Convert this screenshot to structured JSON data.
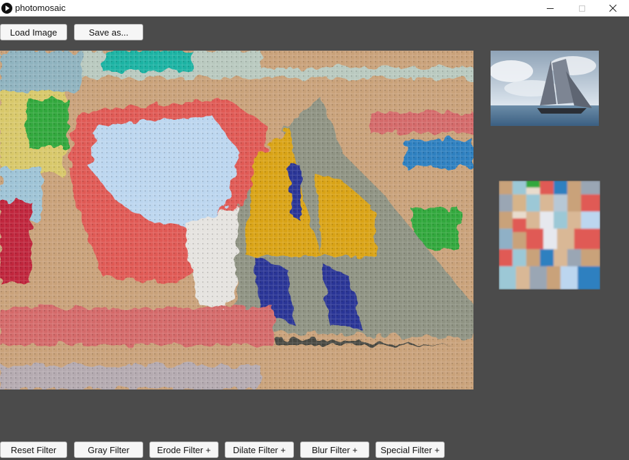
{
  "window": {
    "title": "photomosaic"
  },
  "toolbar": {
    "load_label": "Load Image",
    "save_label": "Save as..."
  },
  "filters": {
    "reset": "Reset Filter",
    "gray": "Gray Filter",
    "erode": "Erode Filter +",
    "dilate": "Dilate Filter +",
    "blur": "Blur Filter +",
    "special": "Special Filter +"
  },
  "colors": {
    "background": "#4b4b4b",
    "tile_tan": "#c9a27a",
    "tile_red": "#e05a55",
    "tile_lightblue": "#bcd6ef",
    "tile_gold": "#d9a318",
    "tile_navy": "#2a3596",
    "tile_gray": "#9a9e92",
    "tile_green": "#33a83c",
    "tile_blue": "#2f80c0"
  }
}
